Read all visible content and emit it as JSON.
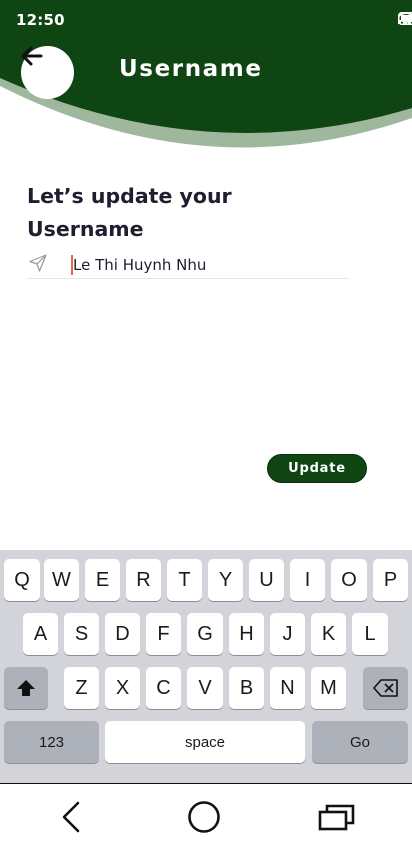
{
  "status_bar": {
    "time": "12:50"
  },
  "header": {
    "title": "Username"
  },
  "main": {
    "heading_line1": "Let’s update your",
    "heading_line2": "Username",
    "username_value": "Le Thi Huynh Nhu",
    "update_label": "Update"
  },
  "keyboard": {
    "row1": [
      "Q",
      "W",
      "E",
      "R",
      "T",
      "Y",
      "U",
      "I",
      "O",
      "P"
    ],
    "row2": [
      "A",
      "S",
      "D",
      "F",
      "G",
      "H",
      "J",
      "K",
      "L"
    ],
    "row3": [
      "Z",
      "X",
      "C",
      "V",
      "B",
      "N",
      "M"
    ],
    "numbers_label": "123",
    "space_label": "space",
    "go_label": "Go"
  },
  "colors": {
    "header_green": "#0e4513",
    "arc_light": "#9fb89d",
    "keyboard_bg": "#d2d4da",
    "cursor": "#e06a48"
  },
  "icons": [
    "back-arrow-icon",
    "signal-icon",
    "wifi-icon",
    "battery-icon",
    "send-icon",
    "shift-icon",
    "backspace-icon",
    "nav-back-icon",
    "nav-home-icon",
    "nav-recents-icon"
  ]
}
